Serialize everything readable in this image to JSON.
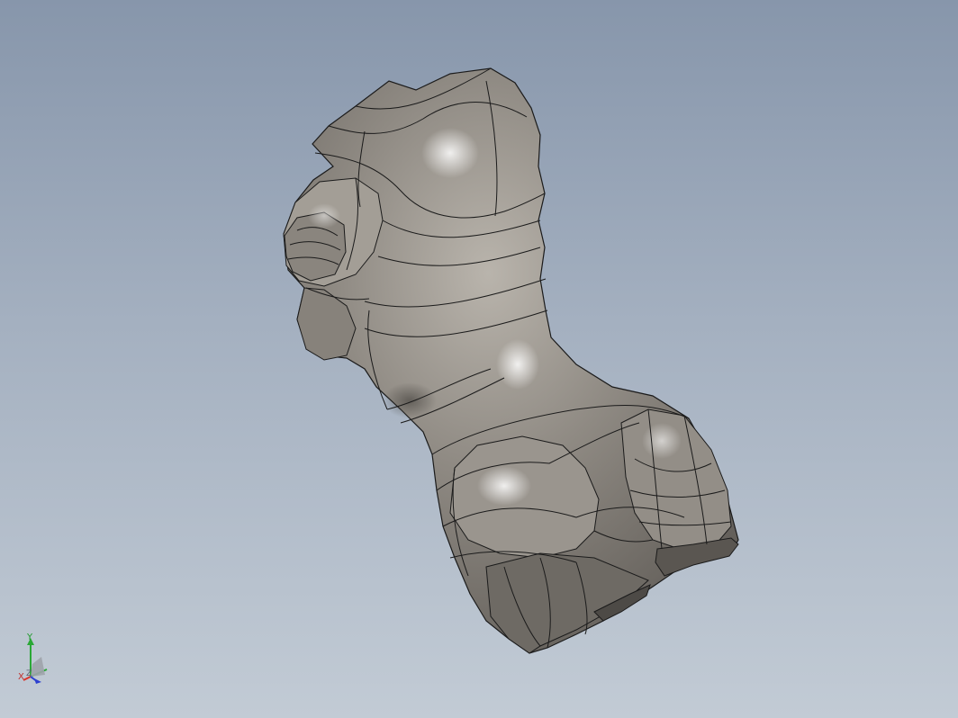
{
  "viewport": {
    "background_top": "#8796ab",
    "background_bottom": "#c2cbd5"
  },
  "model": {
    "subject": "torso-surface-model",
    "surface_color": "#8f8a83",
    "edge_color": "#1b1b1b"
  },
  "triad": {
    "x_label": "X",
    "y_label": "Y",
    "z_label": "Z",
    "x_color": "#d8342c",
    "y_color": "#2aa836",
    "z_color": "#2c3fd0"
  }
}
